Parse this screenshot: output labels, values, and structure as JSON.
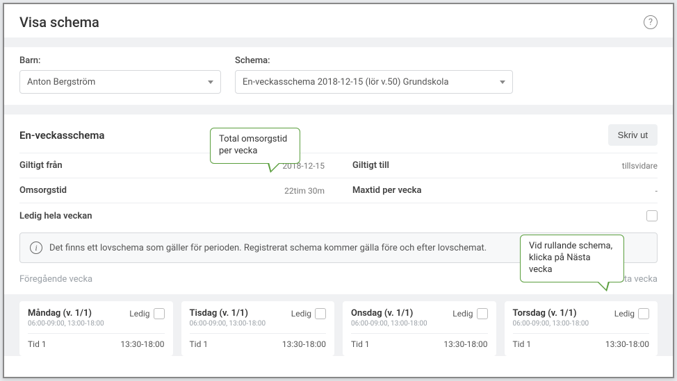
{
  "header": {
    "title": "Visa schema"
  },
  "filters": {
    "child_label": "Barn:",
    "child_value": "Anton Bergström",
    "schema_label": "Schema:",
    "schema_value": "En-veckasschema 2018-12-15 (lör v.50) Grundskola"
  },
  "section": {
    "title": "En-veckasschema",
    "print_button": "Skriv ut",
    "valid_from_label": "Giltigt från",
    "valid_from_value": "2018-12-15",
    "valid_to_label": "Giltigt till",
    "valid_to_value": "tillsvidare",
    "caretime_label": "Omsorgstid",
    "caretime_value": "22tim 30m",
    "maxtime_label": "Maxtid per vecka",
    "maxtime_value": "-",
    "off_week_label": "Ledig hela veckan",
    "banner_text": "Det finns ett lovschema som gäller för perioden. Registrerat schema kommer gälla före och efter lovschemat.",
    "prev_week": "Föregående vecka",
    "next_week": "Nästa vecka"
  },
  "days": [
    {
      "title": "Måndag (v. 1/1)",
      "sub": "06:00-09:00, 13:00-18:00",
      "ledig_label": "Ledig",
      "slot_label": "Tid 1",
      "slot_time": "13:30-18:00"
    },
    {
      "title": "Tisdag (v. 1/1)",
      "sub": "06:00-09:00, 13:00-18:00",
      "ledig_label": "Ledig",
      "slot_label": "Tid 1",
      "slot_time": "13:30-18:00"
    },
    {
      "title": "Onsdag (v. 1/1)",
      "sub": "06:00-09:00, 13:00-18:00",
      "ledig_label": "Ledig",
      "slot_label": "Tid 1",
      "slot_time": "13:30-18:00"
    },
    {
      "title": "Torsdag (v. 1/1)",
      "sub": "06:00-09:00, 13:00-18:00",
      "ledig_label": "Ledig",
      "slot_label": "Tid 1",
      "slot_time": "13:30-18:00"
    }
  ],
  "callouts": {
    "c1_line1": "Total omsorgstid",
    "c1_line2": "per vecka",
    "c2_line1": "Vid rullande schema,",
    "c2_line2": "klicka på Nästa vecka"
  }
}
